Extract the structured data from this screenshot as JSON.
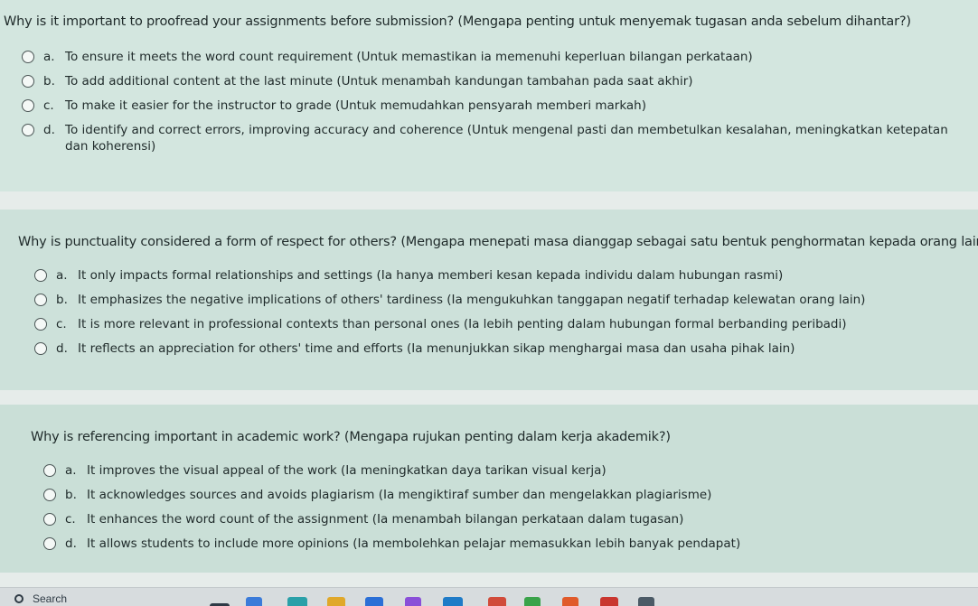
{
  "questions": [
    {
      "text": "Why is it important to proofread your assignments before submission? (Mengapa penting untuk menyemak tugasan anda sebelum dihantar?)",
      "options": [
        {
          "letter": "a.",
          "text": "To ensure it meets the word count requirement (Untuk memastikan ia memenuhi keperluan bilangan perkataan)"
        },
        {
          "letter": "b.",
          "text": "To add additional content at the last minute (Untuk menambah kandungan tambahan pada saat akhir)"
        },
        {
          "letter": "c.",
          "text": "To make it easier for the instructor to grade (Untuk memudahkan pensyarah memberi markah)"
        },
        {
          "letter": "d.",
          "text": "To identify and correct errors, improving accuracy and coherence (Untuk mengenal pasti dan membetulkan kesalahan, meningkatkan ketepatan dan koherensi)"
        }
      ]
    },
    {
      "text": "Why is punctuality considered a form of respect for others? (Mengapa menepati masa dianggap sebagai satu bentuk penghormatan kepada orang lain?)",
      "options": [
        {
          "letter": "a.",
          "text": "It only impacts formal relationships and settings (Ia hanya memberi kesan kepada individu dalam hubungan rasmi)"
        },
        {
          "letter": "b.",
          "text": "It emphasizes the negative implications of others' tardiness (Ia mengukuhkan tanggapan negatif terhadap kelewatan orang lain)"
        },
        {
          "letter": "c.",
          "text": "It is more relevant in professional contexts than personal ones (Ia lebih penting dalam hubungan formal berbanding peribadi)"
        },
        {
          "letter": "d.",
          "text": "It reflects an appreciation for others' time and efforts (Ia menunjukkan sikap menghargai masa dan usaha pihak lain)"
        }
      ]
    },
    {
      "text": "Why is referencing important in academic work? (Mengapa rujukan penting dalam kerja akademik?)",
      "options": [
        {
          "letter": "a.",
          "text": "It improves the visual appeal of the work (Ia meningkatkan daya tarikan visual kerja)"
        },
        {
          "letter": "b.",
          "text": "It acknowledges sources and avoids plagiarism (Ia mengiktiraf sumber dan mengelakkan plagiarisme)"
        },
        {
          "letter": "c.",
          "text": "It enhances the word count of the assignment (Ia menambah bilangan perkataan dalam tugasan)"
        },
        {
          "letter": "d.",
          "text": "It allows students to include more opinions (Ia membolehkan pelajar memasukkan lebih banyak pendapat)"
        }
      ]
    }
  ],
  "taskbar": {
    "search_label": "Search",
    "search_icon": "search-icon"
  },
  "colors": {
    "card": "#cfe3dc",
    "background": "#e6ecea",
    "taskbar": "#d7dcde"
  }
}
